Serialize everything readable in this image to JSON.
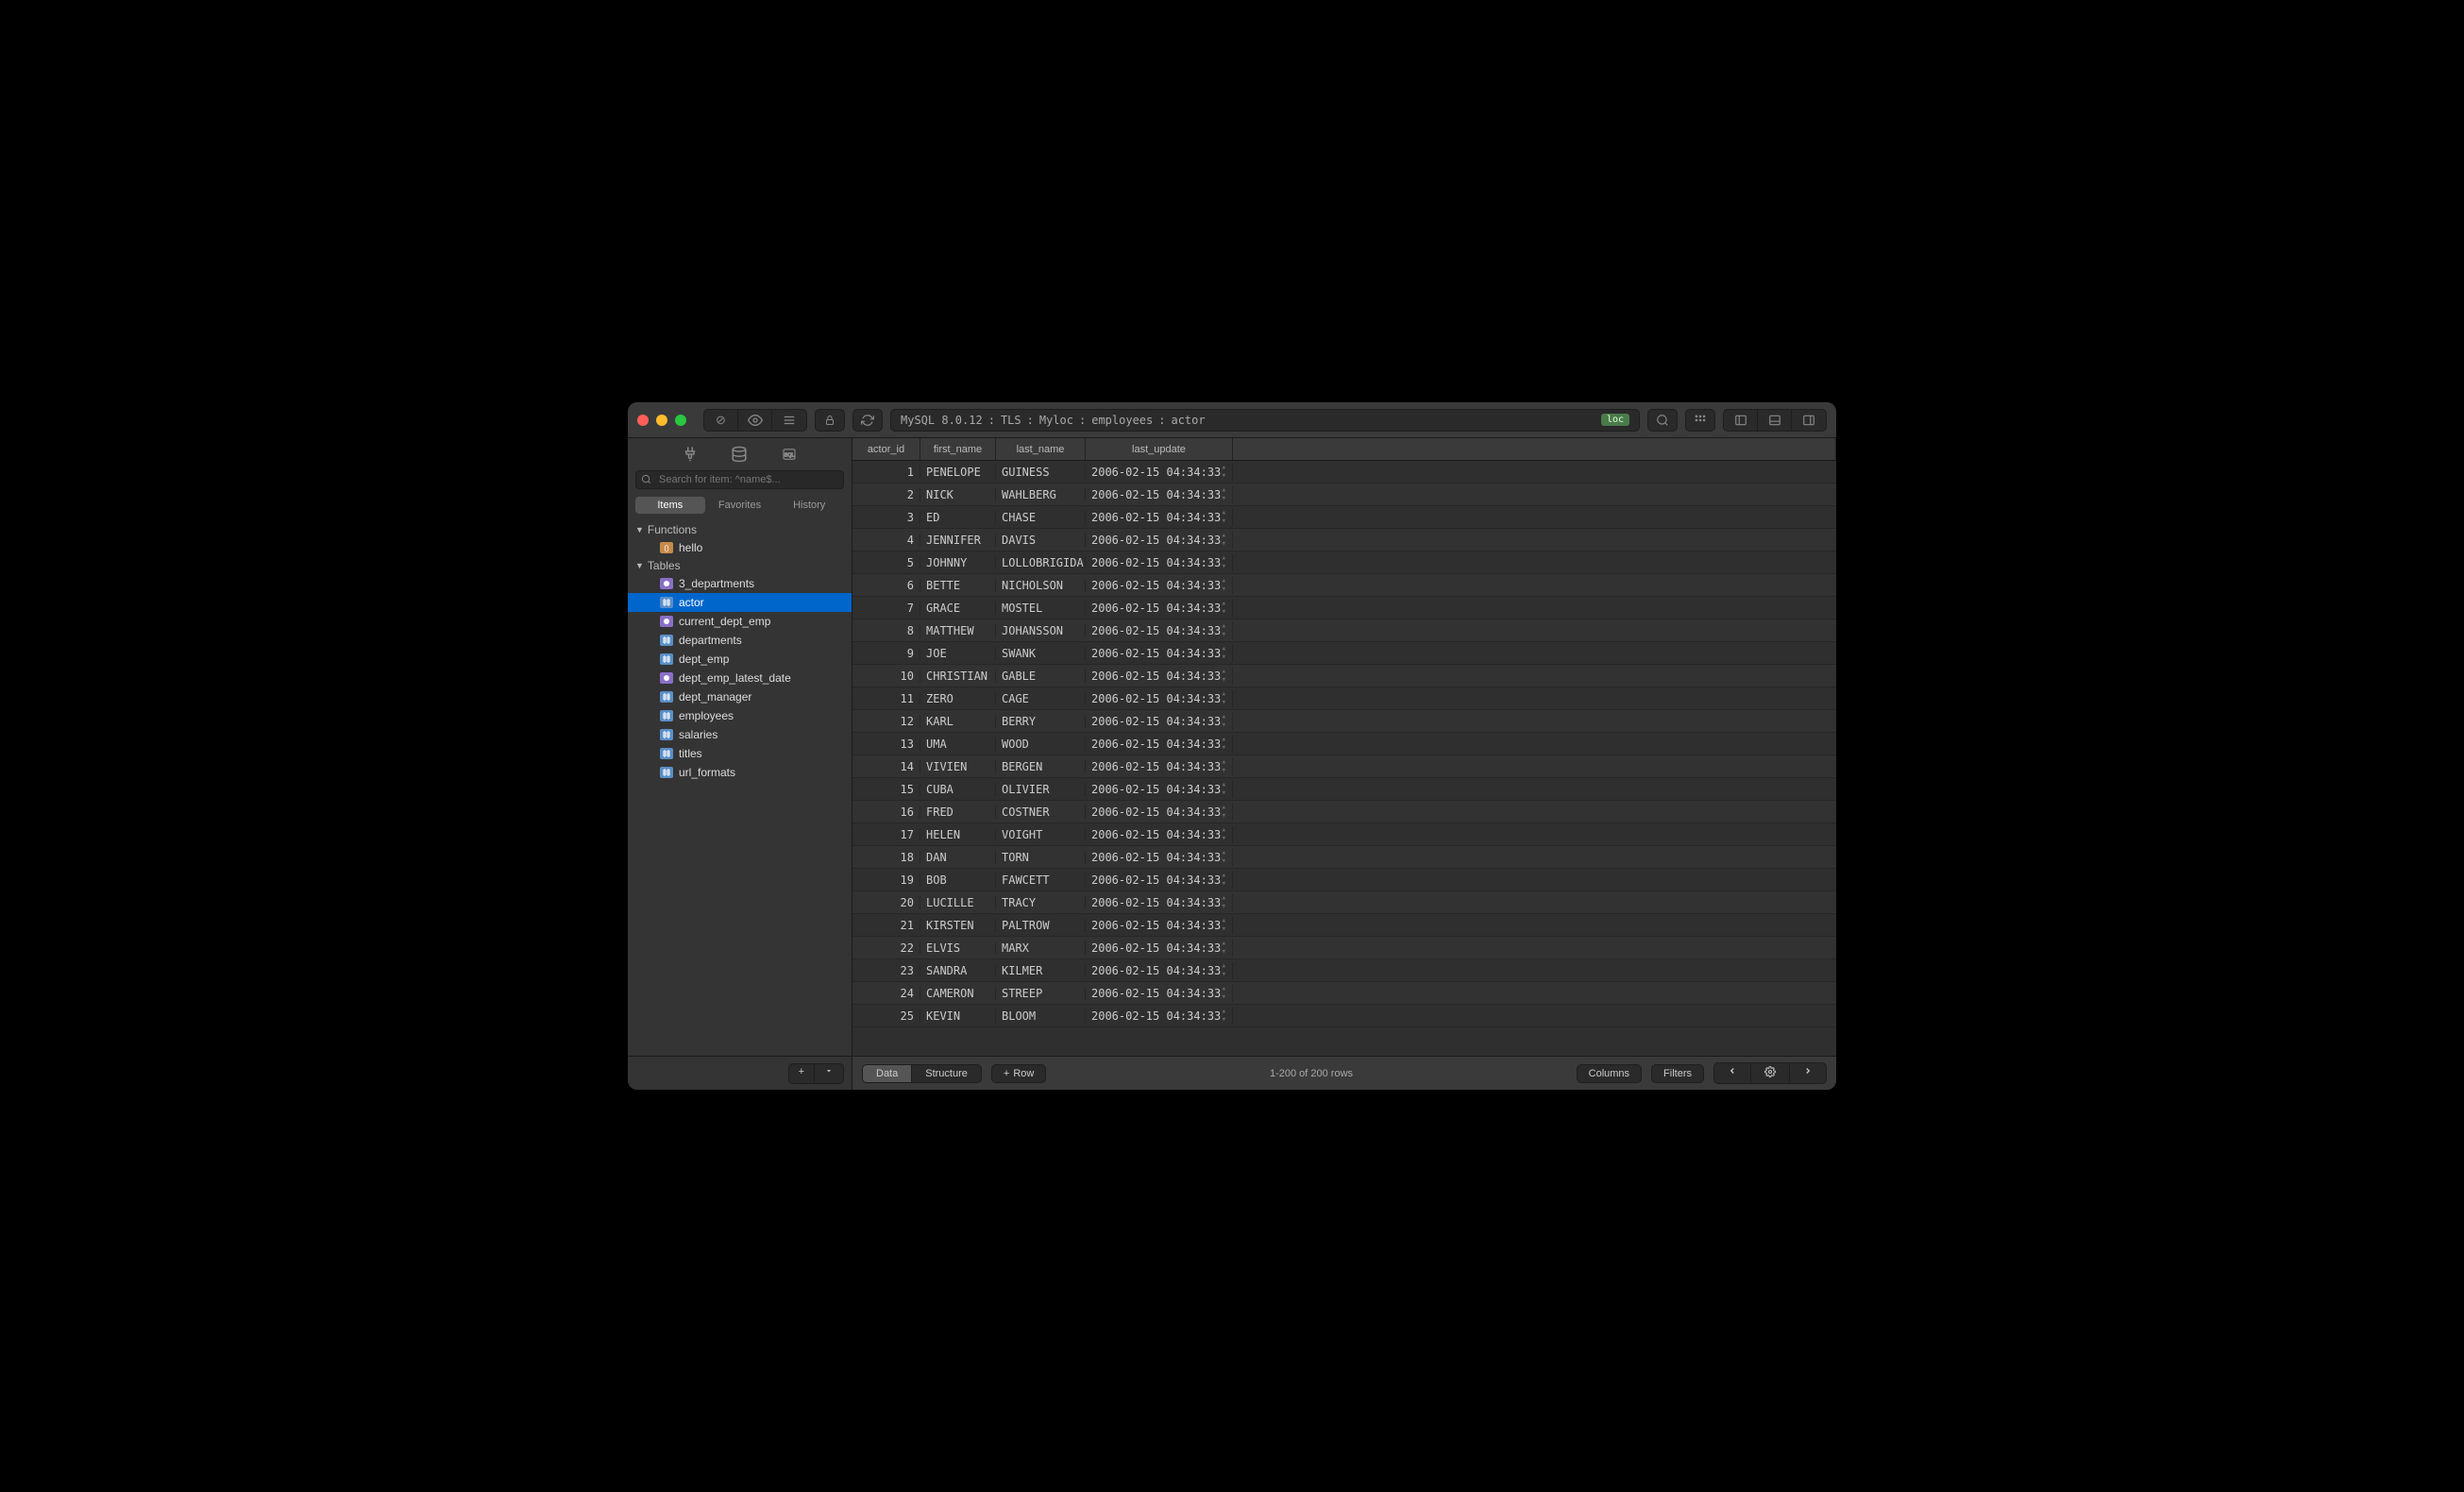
{
  "breadcrumb": {
    "engine": "MySQL 8.0.12",
    "sep": ":",
    "tls": "TLS",
    "host": "Myloc",
    "db": "employees",
    "table": "actor",
    "loc": "loc"
  },
  "search": {
    "placeholder": "Search for item: ^name$..."
  },
  "sidebarTabs": {
    "items": "Items",
    "favorites": "Favorites",
    "history": "History"
  },
  "tree": {
    "functions": {
      "label": "Functions",
      "items": [
        "hello"
      ]
    },
    "tables": {
      "label": "Tables",
      "items": [
        {
          "name": "3_departments",
          "type": "view"
        },
        {
          "name": "actor",
          "type": "table",
          "selected": true
        },
        {
          "name": "current_dept_emp",
          "type": "view"
        },
        {
          "name": "departments",
          "type": "table"
        },
        {
          "name": "dept_emp",
          "type": "table"
        },
        {
          "name": "dept_emp_latest_date",
          "type": "view"
        },
        {
          "name": "dept_manager",
          "type": "table"
        },
        {
          "name": "employees",
          "type": "table"
        },
        {
          "name": "salaries",
          "type": "table"
        },
        {
          "name": "titles",
          "type": "table"
        },
        {
          "name": "url_formats",
          "type": "table"
        }
      ]
    }
  },
  "columns": [
    "actor_id",
    "first_name",
    "last_name",
    "last_update"
  ],
  "rows": [
    [
      1,
      "PENELOPE",
      "GUINESS",
      "2006-02-15 04:34:33"
    ],
    [
      2,
      "NICK",
      "WAHLBERG",
      "2006-02-15 04:34:33"
    ],
    [
      3,
      "ED",
      "CHASE",
      "2006-02-15 04:34:33"
    ],
    [
      4,
      "JENNIFER",
      "DAVIS",
      "2006-02-15 04:34:33"
    ],
    [
      5,
      "JOHNNY",
      "LOLLOBRIGIDA",
      "2006-02-15 04:34:33"
    ],
    [
      6,
      "BETTE",
      "NICHOLSON",
      "2006-02-15 04:34:33"
    ],
    [
      7,
      "GRACE",
      "MOSTEL",
      "2006-02-15 04:34:33"
    ],
    [
      8,
      "MATTHEW",
      "JOHANSSON",
      "2006-02-15 04:34:33"
    ],
    [
      9,
      "JOE",
      "SWANK",
      "2006-02-15 04:34:33"
    ],
    [
      10,
      "CHRISTIAN",
      "GABLE",
      "2006-02-15 04:34:33"
    ],
    [
      11,
      "ZERO",
      "CAGE",
      "2006-02-15 04:34:33"
    ],
    [
      12,
      "KARL",
      "BERRY",
      "2006-02-15 04:34:33"
    ],
    [
      13,
      "UMA",
      "WOOD",
      "2006-02-15 04:34:33"
    ],
    [
      14,
      "VIVIEN",
      "BERGEN",
      "2006-02-15 04:34:33"
    ],
    [
      15,
      "CUBA",
      "OLIVIER",
      "2006-02-15 04:34:33"
    ],
    [
      16,
      "FRED",
      "COSTNER",
      "2006-02-15 04:34:33"
    ],
    [
      17,
      "HELEN",
      "VOIGHT",
      "2006-02-15 04:34:33"
    ],
    [
      18,
      "DAN",
      "TORN",
      "2006-02-15 04:34:33"
    ],
    [
      19,
      "BOB",
      "FAWCETT",
      "2006-02-15 04:34:33"
    ],
    [
      20,
      "LUCILLE",
      "TRACY",
      "2006-02-15 04:34:33"
    ],
    [
      21,
      "KIRSTEN",
      "PALTROW",
      "2006-02-15 04:34:33"
    ],
    [
      22,
      "ELVIS",
      "MARX",
      "2006-02-15 04:34:33"
    ],
    [
      23,
      "SANDRA",
      "KILMER",
      "2006-02-15 04:34:33"
    ],
    [
      24,
      "CAMERON",
      "STREEP",
      "2006-02-15 04:34:33"
    ],
    [
      25,
      "KEVIN",
      "BLOOM",
      "2006-02-15 04:34:33"
    ]
  ],
  "footer": {
    "data": "Data",
    "structure": "Structure",
    "row": "Row",
    "status": "1-200 of 200 rows",
    "columns": "Columns",
    "filters": "Filters"
  }
}
